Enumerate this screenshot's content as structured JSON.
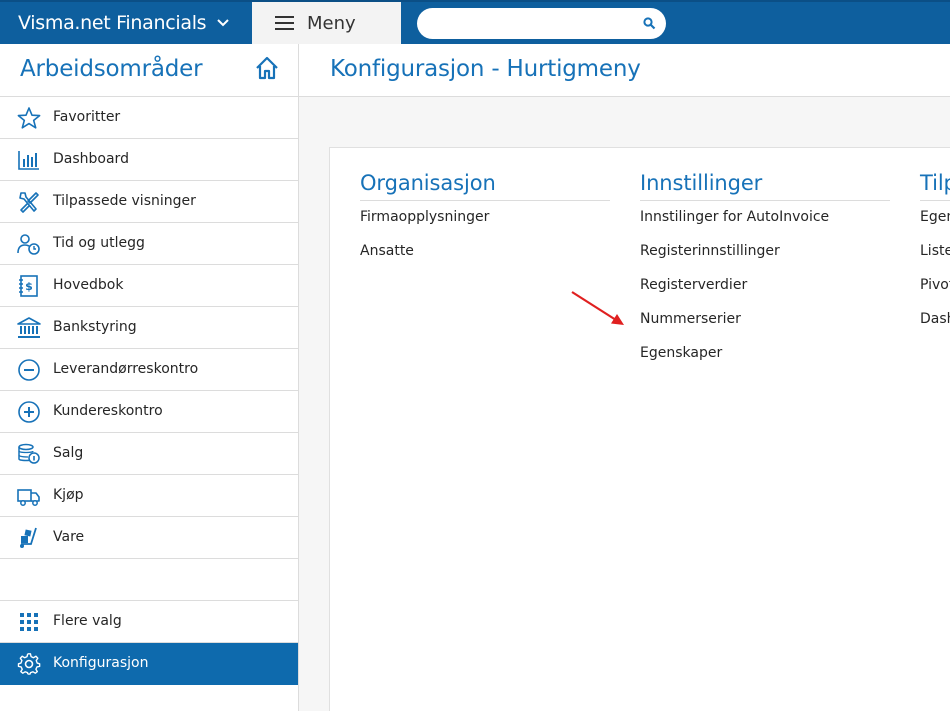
{
  "topbar": {
    "brand": "Visma.net Financials",
    "menu_label": "Meny",
    "search_placeholder": ""
  },
  "sidebar": {
    "title": "Arbeidsområder",
    "items": [
      {
        "label": "Favoritter",
        "icon": "star-icon"
      },
      {
        "label": "Dashboard",
        "icon": "bar-chart-icon"
      },
      {
        "label": "Tilpassede visninger",
        "icon": "wrench-screwdriver-icon"
      },
      {
        "label": "Tid og utlegg",
        "icon": "person-clock-icon"
      },
      {
        "label": "Hovedbok",
        "icon": "ledger-dollar-icon"
      },
      {
        "label": "Bankstyring",
        "icon": "bank-icon"
      },
      {
        "label": "Leverandørreskontro",
        "icon": "minus-circle-icon"
      },
      {
        "label": "Kundereskontro",
        "icon": "plus-circle-icon"
      },
      {
        "label": "Salg",
        "icon": "coins-icon"
      },
      {
        "label": "Kjøp",
        "icon": "truck-icon"
      },
      {
        "label": "Vare",
        "icon": "hand-truck-icon"
      }
    ],
    "bottom_items": [
      {
        "label": "Flere valg",
        "icon": "grid-dots-icon"
      },
      {
        "label": "Konfigurasjon",
        "icon": "gear-icon",
        "active": true
      }
    ]
  },
  "page": {
    "title": "Konfigurasjon - Hurtigmeny",
    "columns": [
      {
        "heading": "Organisasjon",
        "links": [
          "Firmaopplysninger",
          "Ansatte"
        ]
      },
      {
        "heading": "Innstillinger",
        "links": [
          "Innstilinger for AutoInvoice",
          "Registerinnstillinger",
          "Registerverdier",
          "Nummerserier",
          "Egenskaper"
        ]
      },
      {
        "heading": "Tilp",
        "links": [
          "Egen",
          "Liste",
          "Pivot",
          "Dash"
        ]
      }
    ]
  },
  "colors": {
    "topbar": "#0e5f9e",
    "accent": "#1772b8",
    "active_item": "#0e6aad",
    "annotation_arrow": "#e02020"
  }
}
